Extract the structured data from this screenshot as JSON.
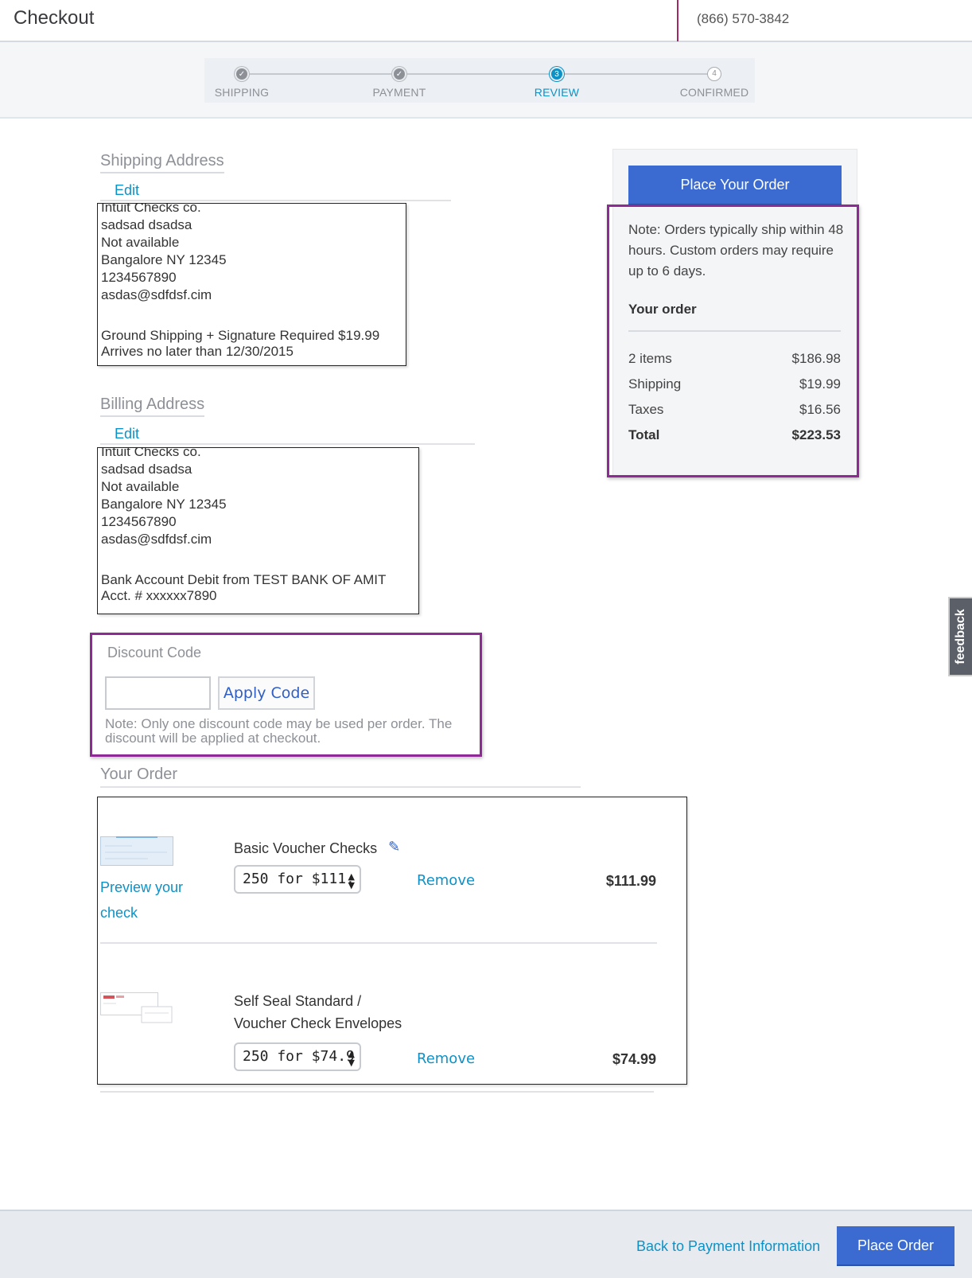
{
  "header": {
    "title": "Checkout",
    "phone": "(866) 570-3842"
  },
  "progress": {
    "steps": [
      {
        "label": "SHIPPING",
        "state": "done",
        "marker": "✓"
      },
      {
        "label": "PAYMENT",
        "state": "done",
        "marker": "✓"
      },
      {
        "label": "REVIEW",
        "state": "current",
        "marker": "3"
      },
      {
        "label": "CONFIRMED",
        "state": "todo",
        "marker": "4"
      }
    ]
  },
  "shipping": {
    "title": "Shipping Address",
    "edit_label": "Edit",
    "lines": [
      "Intuit Checks co.",
      "sadsad dsadsa",
      "Not available",
      "Bangalore NY 12345",
      "1234567890",
      "asdas@sdfdsf.cim"
    ],
    "method": "Ground Shipping + Signature Required $19.99",
    "arrival": "Arrives no later than 12/30/2015"
  },
  "billing": {
    "title": "Billing Address",
    "edit_label": "Edit",
    "lines": [
      "Intuit Checks co.",
      "sadsad dsadsa",
      "Not available",
      "Bangalore NY 12345",
      "1234567890",
      "asdas@sdfdsf.cim"
    ],
    "payment": "Bank Account Debit from TEST BANK OF AMIT",
    "account": "Acct. # xxxxxx7890"
  },
  "discount": {
    "label": "Discount Code",
    "value": "",
    "apply_label": "Apply Code",
    "note": "Note: Only one discount code may be used per order. The discount will be applied at checkout."
  },
  "order": {
    "title": "Your Order",
    "items": [
      {
        "name": "Basic Voucher Checks",
        "qty": "250 for $111.",
        "remove_label": "Remove",
        "price": "$111.99",
        "preview_label": "Preview your check",
        "thumb": "check-thumbnail"
      },
      {
        "name": "Self Seal Standard / Voucher Check Envelopes",
        "qty": "250 for $74.9",
        "remove_label": "Remove",
        "price": "$74.99",
        "thumb": "envelope-thumbnail"
      }
    ]
  },
  "summary": {
    "place_label": "Place Your Order",
    "note": "Note: Orders typically ship within 48 hours. Custom orders may require up to 6 days.",
    "your_order": "Your order",
    "rows": [
      {
        "label": "2 items",
        "value": "$186.98"
      },
      {
        "label": "Shipping",
        "value": "$19.99"
      },
      {
        "label": "Taxes",
        "value": "$16.56"
      },
      {
        "label": "Total",
        "value": "$223.53"
      }
    ]
  },
  "footer": {
    "back_label": "Back to Payment Information",
    "place_label": "Place Order"
  },
  "feedback_label": "feedback",
  "colors": {
    "accent_blue": "#3b6bd0",
    "link_blue": "#0d92c7",
    "highlight_purple": "#8e2a93",
    "header_divider": "#a3286a"
  }
}
